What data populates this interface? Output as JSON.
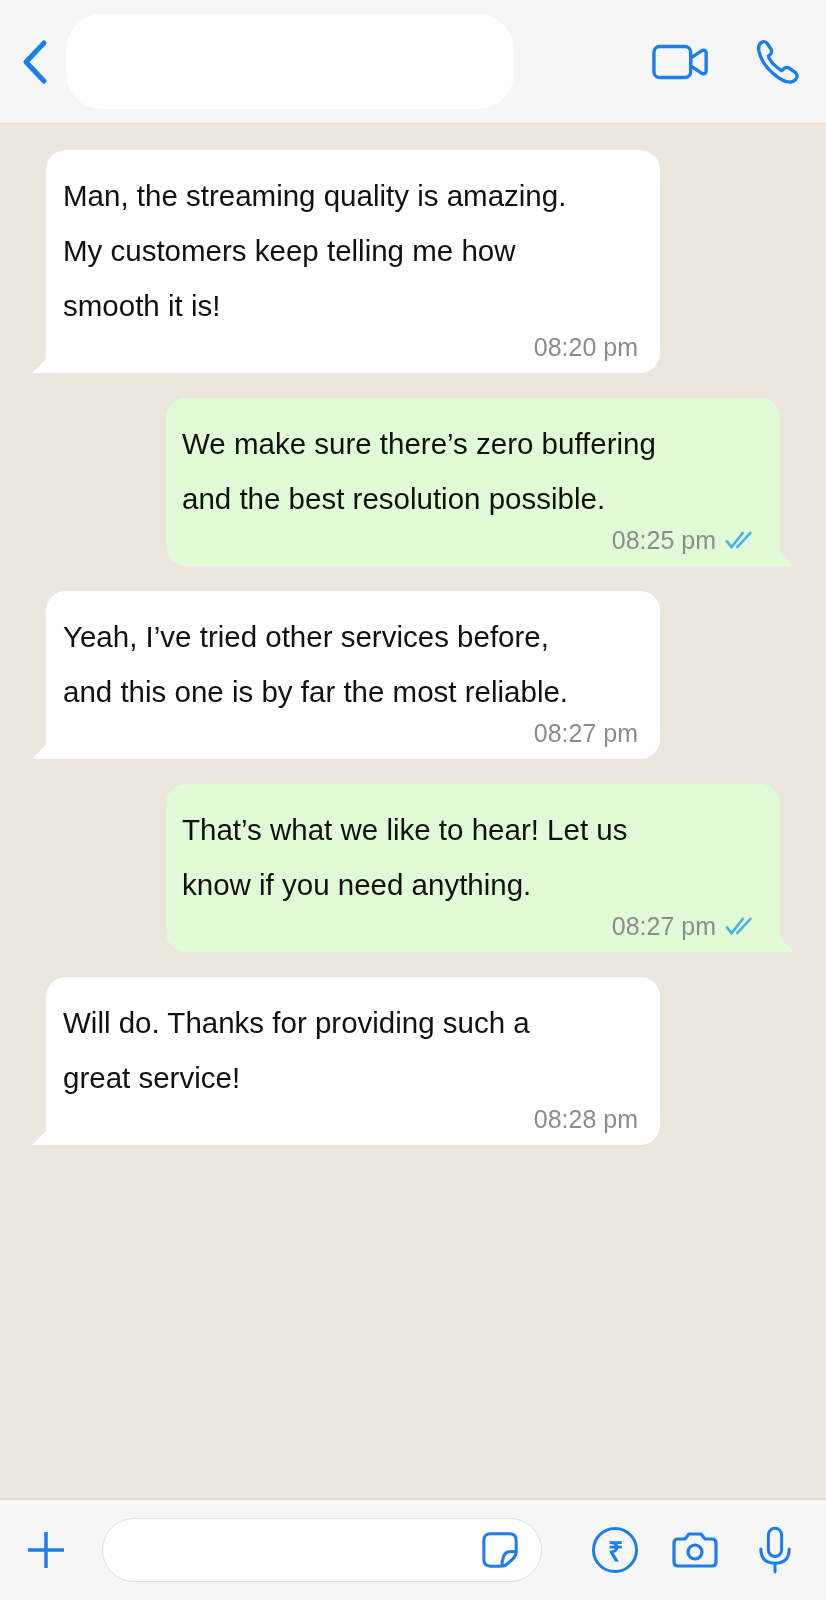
{
  "header": {
    "contact_name_redacted": true
  },
  "messages": [
    {
      "kind": "incoming",
      "text": "Man, the streaming quality is amazing. My customers keep telling me how smooth it is!",
      "time": "08:20 pm"
    },
    {
      "kind": "outgoing",
      "text": "We make sure there’s zero buffering and the best resolution possible.",
      "time": "08:25 pm",
      "read": true
    },
    {
      "kind": "incoming",
      "text": "Yeah, I’ve tried other services before, and this one is by far the most reliable.",
      "time": "08:27 pm"
    },
    {
      "kind": "outgoing",
      "text": "That’s what we like to hear! Let us know if you need anything.",
      "time": "08:27 pm",
      "read": true
    },
    {
      "kind": "incoming",
      "text": "Will do. Thanks for providing such a great service!",
      "time": "08:28 pm"
    }
  ],
  "composer": {
    "payment_symbol": "₹"
  }
}
